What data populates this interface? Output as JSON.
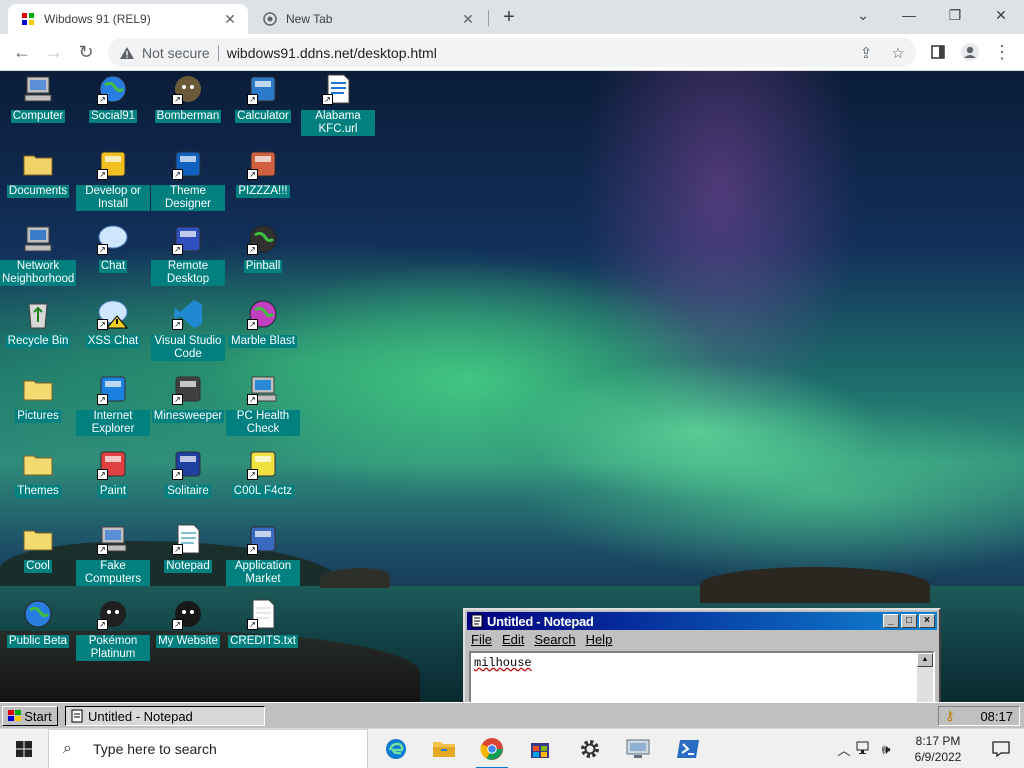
{
  "browser": {
    "tabs": [
      {
        "title": "Wibdows 91 (REL9)",
        "active": true
      },
      {
        "title": "New Tab",
        "active": false
      }
    ],
    "security": "Not secure",
    "url": "wibdows91.ddns.net/desktop.html"
  },
  "desktop": {
    "icons": [
      {
        "label": "Computer",
        "icon": "computer-icon"
      },
      {
        "label": "Social91",
        "icon": "globe-icon"
      },
      {
        "label": "Bomberman",
        "icon": "bomberman-icon"
      },
      {
        "label": "Calculator",
        "icon": "calculator-icon"
      },
      {
        "label": "Alabama KFC.url",
        "icon": "ie-document-icon"
      },
      {
        "label": "Documents",
        "icon": "documents-folder-icon"
      },
      {
        "label": "Develop or Install",
        "icon": "help-computer-icon"
      },
      {
        "label": "Theme Designer",
        "icon": "window-icon"
      },
      {
        "label": "PIZZZA!!!",
        "icon": "pizza-icon"
      },
      {
        "label": "Network Neighborhood",
        "icon": "network-icon"
      },
      {
        "label": "Chat",
        "icon": "chat-bubble-icon"
      },
      {
        "label": "Remote Desktop",
        "icon": "remote-desktop-icon"
      },
      {
        "label": "Pinball",
        "icon": "pinball-icon"
      },
      {
        "label": "Recycle Bin",
        "icon": "recycle-bin-icon"
      },
      {
        "label": "XSS Chat",
        "icon": "warning-chat-icon"
      },
      {
        "label": "Visual Studio Code",
        "icon": "vscode-icon"
      },
      {
        "label": "Marble Blast",
        "icon": "marble-icon"
      },
      {
        "label": "Pictures",
        "icon": "folder-icon"
      },
      {
        "label": "Internet Explorer",
        "icon": "ie-icon"
      },
      {
        "label": "Minesweeper",
        "icon": "mine-icon"
      },
      {
        "label": "PC Health Check",
        "icon": "health-check-icon"
      },
      {
        "label": "Themes",
        "icon": "folder-icon"
      },
      {
        "label": "Paint",
        "icon": "paint-icon"
      },
      {
        "label": "Solitaire",
        "icon": "cards-icon"
      },
      {
        "label": "C00L F4ctz",
        "icon": "lightbulb-icon"
      },
      {
        "label": "Cool",
        "icon": "folder-icon"
      },
      {
        "label": "Fake Computers",
        "icon": "computer-icon"
      },
      {
        "label": "Notepad",
        "icon": "notepad-icon"
      },
      {
        "label": "Application Market",
        "icon": "shopping-bag-icon"
      },
      {
        "label": "Public Beta",
        "icon": "globe-icon"
      },
      {
        "label": "Pokémon Platinum",
        "icon": "pokemon-icon"
      },
      {
        "label": "My Website",
        "icon": "github-icon"
      },
      {
        "label": "CREDITS.txt",
        "icon": "text-file-icon"
      }
    ]
  },
  "notepad": {
    "title": "Untitled - Notepad",
    "menu": [
      "File",
      "Edit",
      "Search",
      "Help"
    ],
    "text": "milhouse"
  },
  "w9taskbar": {
    "start_label": "Start",
    "task_label": "Untitled - Notepad",
    "clock": "08:17"
  },
  "w10taskbar": {
    "search_placeholder": "Type here to search",
    "time": "8:17 PM",
    "date": "6/9/2022",
    "apps": [
      "edge-icon",
      "file-explorer-icon",
      "chrome-icon",
      "store-icon",
      "settings-icon",
      "remote-icon",
      "powershell-icon"
    ]
  },
  "colors": {
    "icon_label_bg": "#00807f",
    "win9x_title": "#000080",
    "win9x_face": "#c0c0c0"
  }
}
